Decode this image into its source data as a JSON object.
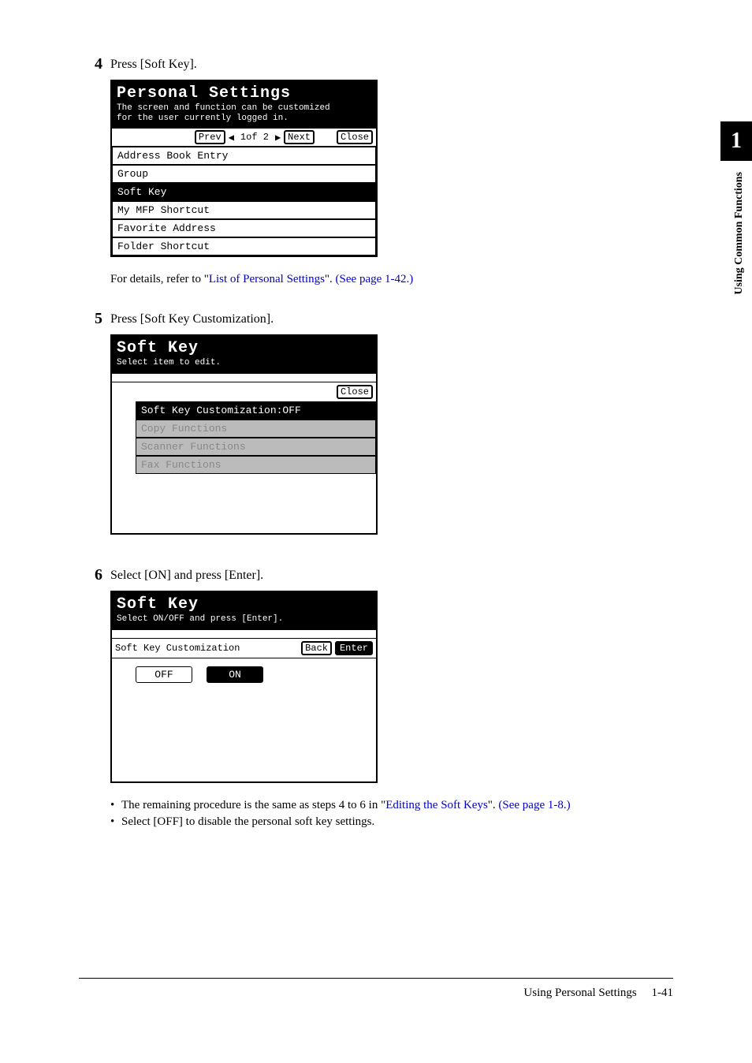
{
  "sideTab": {
    "number": "1",
    "label": "Using Common Functions"
  },
  "steps": {
    "s4": {
      "num": "4",
      "text": "Press [Soft Key]."
    },
    "s5": {
      "num": "5",
      "text": "Press [Soft Key Customization]."
    },
    "s6": {
      "num": "6",
      "text": "Select [ON] and press [Enter]."
    }
  },
  "screen1": {
    "title": "Personal Settings",
    "subtitle1": "The screen and function can be customized",
    "subtitle2": "for the user currently logged in.",
    "prev": "Prev",
    "next": "Next",
    "pageInd": "1of  2",
    "close": "Close",
    "items": [
      "Address Book Entry",
      "Group",
      "Soft Key",
      "My MFP Shortcut",
      "Favorite Address",
      "Folder Shortcut"
    ],
    "selectedIndex": 2
  },
  "detail1": {
    "prefix": "For details, refer to \"",
    "link": "List of Personal Settings",
    "mid": "\". ",
    "link2": "(See page 1-42.)"
  },
  "screen2": {
    "title": "Soft Key",
    "subtitle": "Select item to edit.",
    "close": "Close",
    "items": [
      {
        "label": "Soft Key Customization:OFF",
        "state": "selected"
      },
      {
        "label": "Copy Functions",
        "state": "disabled"
      },
      {
        "label": "Scanner Functions",
        "state": "disabled"
      },
      {
        "label": "Fax Functions",
        "state": "disabled"
      }
    ]
  },
  "screen3": {
    "title": "Soft Key",
    "subtitle": "Select ON/OFF and press [Enter].",
    "label": "Soft Key Customization",
    "back": "Back",
    "enter": "Enter",
    "off": "OFF",
    "on": "ON"
  },
  "bullets": {
    "b1_pre": "The remaining procedure is the same as steps 4 to 6 in \"",
    "b1_link1": "Editing the Soft Keys",
    "b1_mid": "\". ",
    "b1_link2": "(See page 1-8.)",
    "b2": "Select [OFF] to disable the personal soft key settings."
  },
  "footer": {
    "title": "Using Personal Settings",
    "page": "1-41"
  }
}
